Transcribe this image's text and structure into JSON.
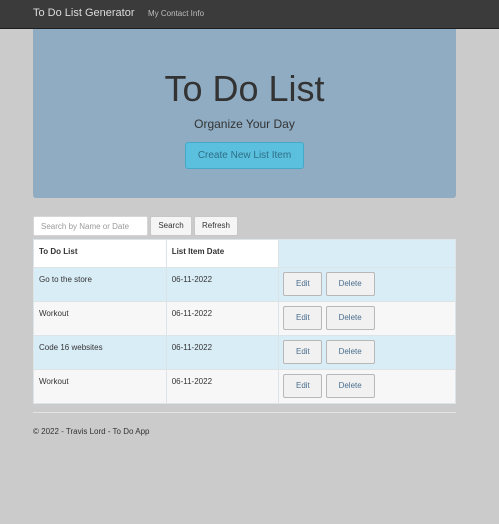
{
  "navbar": {
    "brand": "To Do List Generator",
    "links": [
      "My Contact Info"
    ]
  },
  "hero": {
    "title": "To Do List",
    "subtitle": "Organize Your Day",
    "create_button": "Create New List Item"
  },
  "search": {
    "placeholder": "Search by Name or Date",
    "value": "",
    "search_label": "Search",
    "refresh_label": "Refresh"
  },
  "table": {
    "headers": [
      "To Do List",
      "List Item Date",
      ""
    ],
    "edit_label": "Edit",
    "delete_label": "Delete",
    "rows": [
      {
        "item": "Go to the store",
        "date": "06-11-2022"
      },
      {
        "item": "Workout",
        "date": "06-11-2022"
      },
      {
        "item": "Code 16 websites",
        "date": "06-11-2022"
      },
      {
        "item": "Workout",
        "date": "06-11-2022"
      }
    ]
  },
  "footer": {
    "text": "© 2022 - Travis Lord - To Do App"
  },
  "colors": {
    "navbar": "#3b3b3b",
    "hero": "#8facc3",
    "primary_button": "#5bc0de",
    "row_highlight": "#d9edf7",
    "page_background": "#cccbcb"
  }
}
